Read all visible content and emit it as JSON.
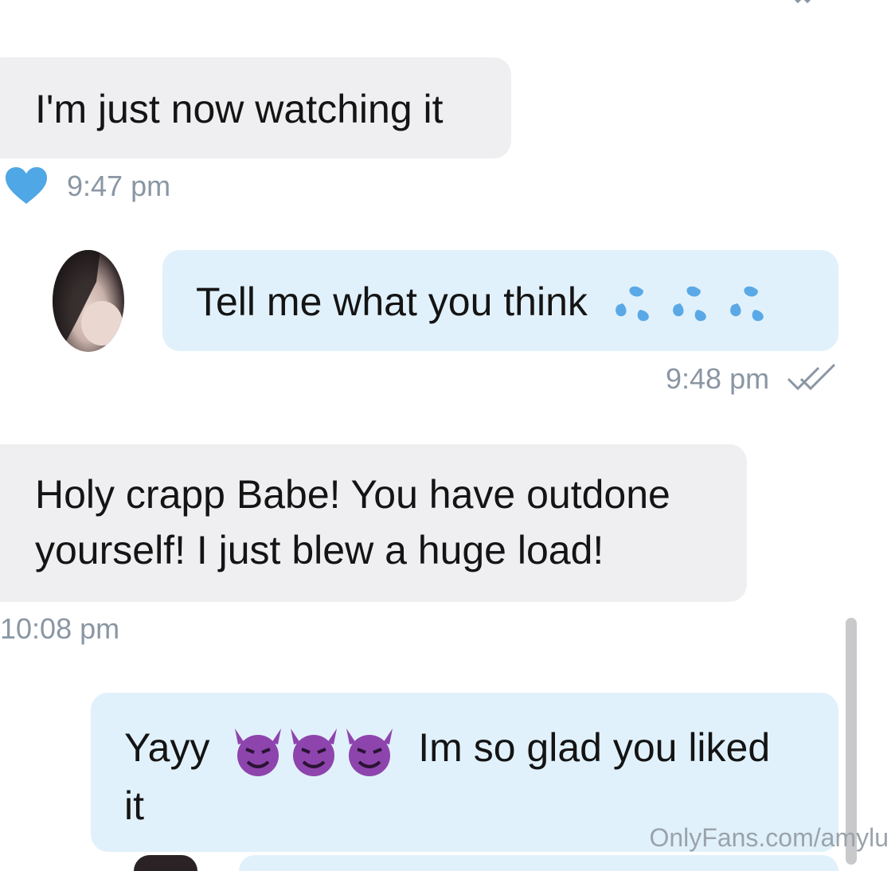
{
  "messages": [
    {
      "text": "I'm just now watching it",
      "time": "9:47 pm"
    },
    {
      "text": "Tell me what you think",
      "time": "9:48 pm"
    },
    {
      "text_line1": "Holy crapp Babe! You have outdone",
      "text_line2": "yourself! I just blew a huge load!",
      "time": "10:08 pm"
    },
    {
      "text_start": "Yayy",
      "text_end": "Im so glad you liked",
      "text_line2": "it"
    }
  ],
  "icons": {
    "like": "heart-icon",
    "read": "double-check-icon",
    "sweat": "sweat-droplets-emoji",
    "devil": "smiling-devil-emoji"
  },
  "colors": {
    "incoming_bubble": "#efeff1",
    "outgoing_bubble": "#e1f1fb",
    "heart": "#4fa7e6",
    "timestamp": "#8a96a3"
  },
  "watermark": "OnlyFans.com/amylu"
}
